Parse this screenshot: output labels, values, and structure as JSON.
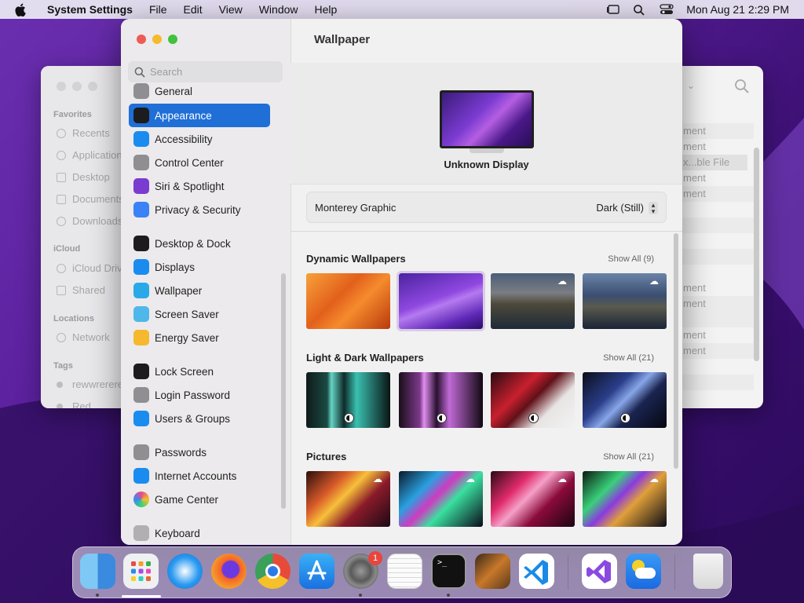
{
  "menubar": {
    "app_name": "System Settings",
    "menus": [
      "File",
      "Edit",
      "View",
      "Window",
      "Help"
    ],
    "clock": "Mon Aug 21  2:29 PM"
  },
  "finder": {
    "sections": {
      "favorites": "Favorites",
      "icloud": "iCloud",
      "locations": "Locations",
      "tags": "Tags"
    },
    "items": [
      "Recents",
      "Applications",
      "Desktop",
      "Documents",
      "Downloads",
      "iCloud Drive",
      "Shared",
      "Network",
      "rewwrerere",
      "Red"
    ],
    "rows": [
      "ment",
      "ment",
      "x...ble File",
      "ment",
      "ment",
      "ment",
      "ment",
      "ment",
      "ment"
    ]
  },
  "settings": {
    "search_placeholder": "Search",
    "sidebar": [
      {
        "label": "General",
        "icon": "gear-icon",
        "color": "#8e8e93"
      },
      {
        "label": "Appearance",
        "icon": "appearance-icon",
        "color": "#1c1c1e",
        "selected": true
      },
      {
        "label": "Accessibility",
        "icon": "accessibility-icon",
        "color": "#1a8cf0"
      },
      {
        "label": "Control Center",
        "icon": "control-center-icon",
        "color": "#8e8e93"
      },
      {
        "label": "Siri & Spotlight",
        "icon": "siri-icon",
        "color": "#7a3bd0"
      },
      {
        "label": "Privacy & Security",
        "icon": "hand-icon",
        "color": "#3a82f6"
      },
      {
        "label": "Desktop & Dock",
        "icon": "dock-icon",
        "color": "#1c1c1e"
      },
      {
        "label": "Displays",
        "icon": "sun-icon",
        "color": "#1a8cf0"
      },
      {
        "label": "Wallpaper",
        "icon": "flower-icon",
        "color": "#2aa9e8"
      },
      {
        "label": "Screen Saver",
        "icon": "screen-saver-icon",
        "color": "#4fb8e8"
      },
      {
        "label": "Energy Saver",
        "icon": "bulb-icon",
        "color": "#f5b82e"
      },
      {
        "label": "Lock Screen",
        "icon": "lock-icon",
        "color": "#1c1c1e"
      },
      {
        "label": "Login Password",
        "icon": "lock-icon",
        "color": "#8e8e93"
      },
      {
        "label": "Users & Groups",
        "icon": "users-icon",
        "color": "#1a8cf0"
      },
      {
        "label": "Passwords",
        "icon": "key-icon",
        "color": "#8e8e93"
      },
      {
        "label": "Internet Accounts",
        "icon": "at-icon",
        "color": "#1a8cf0"
      },
      {
        "label": "Game Center",
        "icon": "game-center-icon",
        "color": "#ffffff"
      },
      {
        "label": "Keyboard",
        "icon": "keyboard-icon",
        "color": "#b0b0b0"
      }
    ],
    "title": "Wallpaper",
    "display_name": "Unknown Display",
    "current_wallpaper": "Monterey Graphic",
    "appearance_value": "Dark (Still)",
    "sections": [
      {
        "title": "Dynamic Wallpapers",
        "show_all": "Show All (9)"
      },
      {
        "title": "Light & Dark Wallpapers",
        "show_all": "Show All (21)"
      },
      {
        "title": "Pictures",
        "show_all": "Show All (21)"
      }
    ]
  },
  "dock": {
    "apps": [
      "Finder",
      "Launchpad",
      "Safari",
      "Firefox",
      "Chrome",
      "App Store",
      "System Settings",
      "TextEdit",
      "Terminal",
      "GarageBand",
      "Visual Studio Code",
      "Visual Studio",
      "Weather",
      "Trash"
    ],
    "badge_count": "1"
  }
}
